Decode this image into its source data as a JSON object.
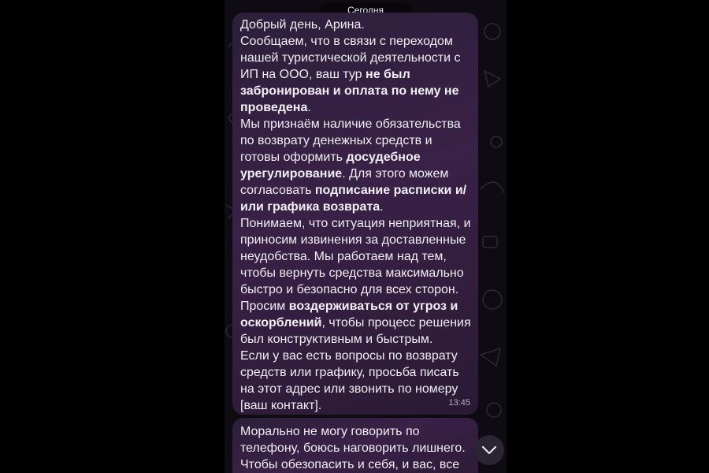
{
  "chat": {
    "date_label": "Сегодня"
  },
  "message_1": {
    "time": "13:45",
    "lines": [
      [
        "Добрый день, Арина."
      ],
      [
        "Сообщаем, что в связи с переходом"
      ],
      [
        "нашей туристической деятельности с"
      ],
      [
        "ИП на ООО, ваш тур ",
        {
          "b": "не был"
        }
      ],
      [
        {
          "b": "забронирован и оплата по нему не"
        }
      ],
      [
        {
          "b": "проведена"
        },
        "."
      ],
      [
        "Мы признаём наличие обязательства"
      ],
      [
        "по возврату денежных средств и"
      ],
      [
        "готовы оформить ",
        {
          "b": "досудебное"
        }
      ],
      [
        {
          "b": "урегулирование"
        },
        ". Для этого можем"
      ],
      [
        "согласовать ",
        {
          "b": "подписание расписки и/"
        }
      ],
      [
        {
          "b": "или графика возврата"
        },
        "."
      ],
      [
        "Понимаем, что ситуация неприятная, и"
      ],
      [
        "приносим извинения за доставленные"
      ],
      [
        "неудобства. Мы работаем над тем,"
      ],
      [
        "чтобы вернуть средства максимально"
      ],
      [
        "быстро и безопасно для всех сторон."
      ],
      [
        "Просим ",
        {
          "b": "воздерживаться от угроз и"
        }
      ],
      [
        {
          "b": "оскорблений"
        },
        ", чтобы процесс решения"
      ],
      [
        "был конструктивным и быстрым."
      ],
      [
        "Если у вас есть вопросы по возврату"
      ],
      [
        "средств или графику, просьба писать"
      ],
      [
        "на этот адрес или звонить по номеру"
      ],
      [
        "[ваш контакт]."
      ]
    ]
  },
  "message_2": {
    "lines": [
      [
        "Морально не могу говорить по"
      ],
      [
        "телефону, боюсь наговорить лишнего."
      ],
      [
        "Чтобы обезопасить и себя, и вас, все"
      ]
    ]
  },
  "icons": {
    "scroll_down": "chevron-down-icon"
  },
  "colors": {
    "bubble": "#3a2147",
    "chat_bg": "#0e0b13",
    "text": "#f1eef5"
  }
}
